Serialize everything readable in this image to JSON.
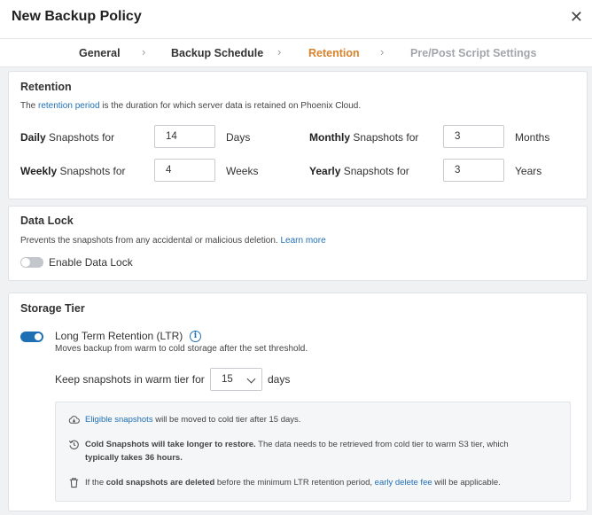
{
  "dialog": {
    "title": "New Backup Policy"
  },
  "steps": [
    {
      "label": "General",
      "state": "done"
    },
    {
      "label": "Backup Schedule",
      "state": "done"
    },
    {
      "label": "Retention",
      "state": "active"
    },
    {
      "label": "Pre/Post Script Settings",
      "state": "pending"
    }
  ],
  "retention": {
    "title": "Retention",
    "desc_prefix": "The",
    "desc_link": "retention period",
    "desc_suffix": "is the duration for which server data is retained on Phoenix Cloud.",
    "daily": {
      "bold": "Daily",
      "label": "Snapshots for",
      "value": "14",
      "unit": "Days"
    },
    "weekly": {
      "bold": "Weekly",
      "label": "Snapshots for",
      "value": "4",
      "unit": "Weeks"
    },
    "monthly": {
      "bold": "Monthly",
      "label": "Snapshots for",
      "value": "3",
      "unit": "Months"
    },
    "yearly": {
      "bold": "Yearly",
      "label": "Snapshots for",
      "value": "3",
      "unit": "Years"
    }
  },
  "data_lock": {
    "title": "Data Lock",
    "desc": "Prevents the snapshots from any accidental or malicious deletion.",
    "learn_more": "Learn more",
    "toggle_label": "Enable Data Lock"
  },
  "storage_tier": {
    "title": "Storage Tier",
    "ltr_label": "Long Term Retention (LTR)",
    "ltr_desc": "Moves backup from warm to cold storage after the set threshold.",
    "keep_label": "Keep snapshots in warm tier for",
    "keep_value": "15",
    "keep_unit": "days",
    "note1_link": "Eligible snapshots",
    "note1_rest": "will be moved to cold tier after 15 days.",
    "note2_bold": "Cold Snapshots will take longer to restore.",
    "note2_rest": "The data needs to be retrieved from cold tier to warm S3 tier, which",
    "note2_bold2": "typically takes 36 hours.",
    "note3_prefix": "If the",
    "note3_bold": "cold snapshots are deleted",
    "note3_mid": "before the minimum LTR retention period,",
    "note3_link": "early delete fee",
    "note3_suffix": "will be applicable."
  },
  "colors": {
    "accent": "#1f6fb5",
    "active_step": "#d9822b"
  },
  "icons": [
    "close-icon",
    "chevron-right-icon",
    "info-icon",
    "cloud-download-icon",
    "restore-clock-icon",
    "trash-icon",
    "chevron-down-icon"
  ]
}
